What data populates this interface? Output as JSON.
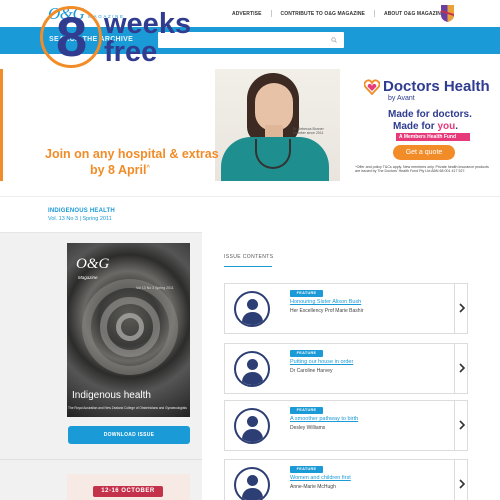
{
  "header": {
    "logo_main": "O&G",
    "logo_sub": "MAGAZINE",
    "nav": [
      "ADVERTISE",
      "CONTRIBUTE TO O&G MAGAZINE",
      "ABOUT O&G MAGAZINE"
    ]
  },
  "search": {
    "label": "SEARCH THE ARCHIVE",
    "placeholder": ""
  },
  "banner": {
    "number": "8",
    "weeks": "weeks",
    "free": "free",
    "tagline_1": "Join on any hospital & extras",
    "tagline_2": "by 8 April",
    "tagline_mark": "^",
    "photo_caption": "Dr Rebecca Bonner\nMember since 2011",
    "brand_title": "Doctors Health",
    "brand_by": "by Avant",
    "made_line1": "Made for doctors.",
    "made_line2_prefix": "Made for ",
    "made_line2_you": "you",
    "fund_label": "A Members Health Fund",
    "quote_button": "Get a quote",
    "fine_print": "^Offer and policy T&Cs apply. New members only. Private health insurance products are issued by The Doctors' Health Fund Pty Ltd ABN 68 001 417 527."
  },
  "issue": {
    "title": "INDIGENOUS HEALTH",
    "subtitle": "Vol. 13 No 3 | Spring 2011"
  },
  "cover": {
    "logo": "O&G",
    "magazine": "Magazine",
    "vol": "Vol 13 No 3 Spring 2011",
    "title": "Indigenous health",
    "strap": "The Royal Australian and New Zealand College of Obstetricians and Gynaecologists",
    "download_label": "DOWNLOAD ISSUE"
  },
  "promo": {
    "dates": "12-16 OCTOBER"
  },
  "contents": {
    "label": "ISSUE CONTENTS",
    "items": [
      {
        "badge": "FEATURE",
        "title": "Honouring Sister Alison Bush",
        "author": "Her Excellency Prof Marie Bashir"
      },
      {
        "badge": "FEATURE",
        "title": "Putting our house in order",
        "author": "Dr Caroline Harvey"
      },
      {
        "badge": "FEATURE",
        "title": "A smoother pathway to birth",
        "author": "Desley Williams"
      },
      {
        "badge": "FEATURE",
        "title": "Women and children first",
        "author": "Anne-Marie McHugh"
      }
    ]
  },
  "colors": {
    "brand_blue": "#1a9ad6",
    "navy": "#2f3c8f",
    "orange": "#f28c28",
    "pink": "#e63a7a",
    "avatar": "#2c3e73"
  },
  "icons": [
    "search-icon",
    "chevron-right-icon",
    "user-avatar-icon",
    "heart-logo-icon",
    "college-crest-icon"
  ]
}
